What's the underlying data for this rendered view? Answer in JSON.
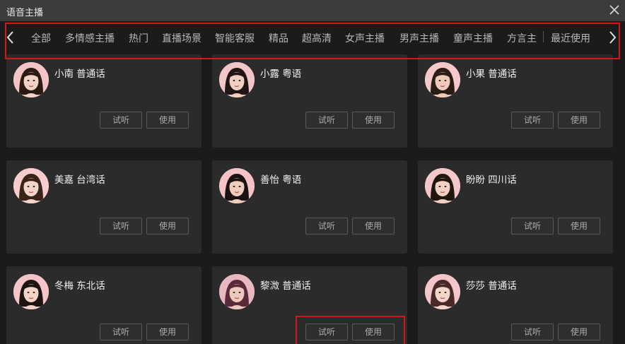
{
  "window": {
    "title": "语音主播"
  },
  "nav": {
    "tabs": [
      "全部",
      "多情感主播",
      "热门",
      "直播场景",
      "智能客服",
      "精品",
      "超高清",
      "女声主播",
      "男声主播",
      "童声主播",
      "方言主",
      "最近使用"
    ]
  },
  "buttons": {
    "listen": "试听",
    "use": "使用"
  },
  "voices": [
    {
      "name": "小南 普通话",
      "skin": "#f2d2c4",
      "hair": "#2a1a12",
      "bg": "#f3c4c6"
    },
    {
      "name": "小露 粤语",
      "skin": "#f0cfc2",
      "hair": "#1f1512",
      "bg": "#f2c6c9"
    },
    {
      "name": "小果 普通话",
      "skin": "#eecab8",
      "hair": "#2b1c14",
      "bg": "#f5c8ca"
    },
    {
      "name": "美嘉 台湾话",
      "skin": "#f3d6c9",
      "hair": "#3a2418",
      "bg": "#f6cccd"
    },
    {
      "name": "善怡 粤语",
      "skin": "#efcdbd",
      "hair": "#1a1210",
      "bg": "#f3c3c6"
    },
    {
      "name": "盼盼 四川话",
      "skin": "#f1d1c2",
      "hair": "#22170f",
      "bg": "#f4c7c9"
    },
    {
      "name": "冬梅 东北话",
      "skin": "#f2d3c5",
      "hair": "#1d1410",
      "bg": "#f3c5c8"
    },
    {
      "name": "黎溦 普通话",
      "skin": "#ecc8bd",
      "hair": "#5a2a3a",
      "bg": "#e9b7c0"
    },
    {
      "name": "莎莎 普通话",
      "skin": "#f3d5ca",
      "hair": "#4a2a26",
      "bg": "#f4c6cb"
    }
  ]
}
